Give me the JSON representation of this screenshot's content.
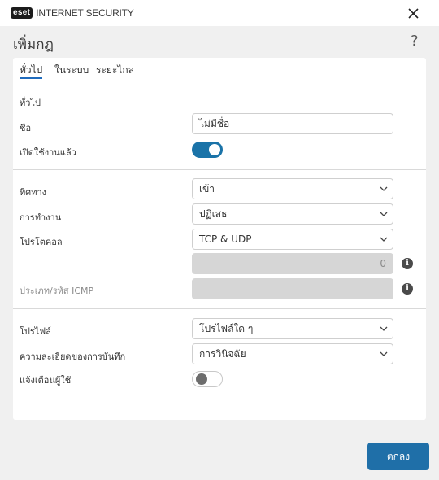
{
  "app": {
    "brand": "eset",
    "product": "INTERNET SECURITY"
  },
  "header": {
    "title": "เพิ่มกฎ",
    "help": "?"
  },
  "tabs": [
    {
      "label": "ทั่วไป",
      "active": true
    },
    {
      "label": "ในระบบ",
      "active": false
    },
    {
      "label": "ระยะไกล",
      "active": false
    }
  ],
  "general": {
    "section_title": "ทั่วไป",
    "name_label": "ชื่อ",
    "name_value": "ไม่มีชื่อ",
    "enabled_label": "เปิดใช้งานแล้ว",
    "enabled": true
  },
  "rule": {
    "direction_label": "ทิศทาง",
    "direction_value": "เข้า",
    "action_label": "การทำงาน",
    "action_value": "ปฏิเสธ",
    "protocol_label": "โปรโตคอล",
    "protocol_value": "TCP & UDP",
    "protocol_number": "0",
    "icmp_label": "ประเภท/รหัส ICMP",
    "icmp_value": ""
  },
  "profile": {
    "profile_label": "โปรไฟล์",
    "profile_value": "โปรไฟล์ใด ๆ",
    "logging_label": "ความละเอียดของการบันทึก",
    "logging_value": "การวินิจฉัย",
    "notify_label": "แจ้งเตือนผู้ใช้",
    "notify": false
  },
  "footer": {
    "ok_label": "ตกลง"
  },
  "colors": {
    "accent": "#1f6fa8",
    "toggle_on": "#1a73a8",
    "tab_underline": "#1f6bbd"
  }
}
